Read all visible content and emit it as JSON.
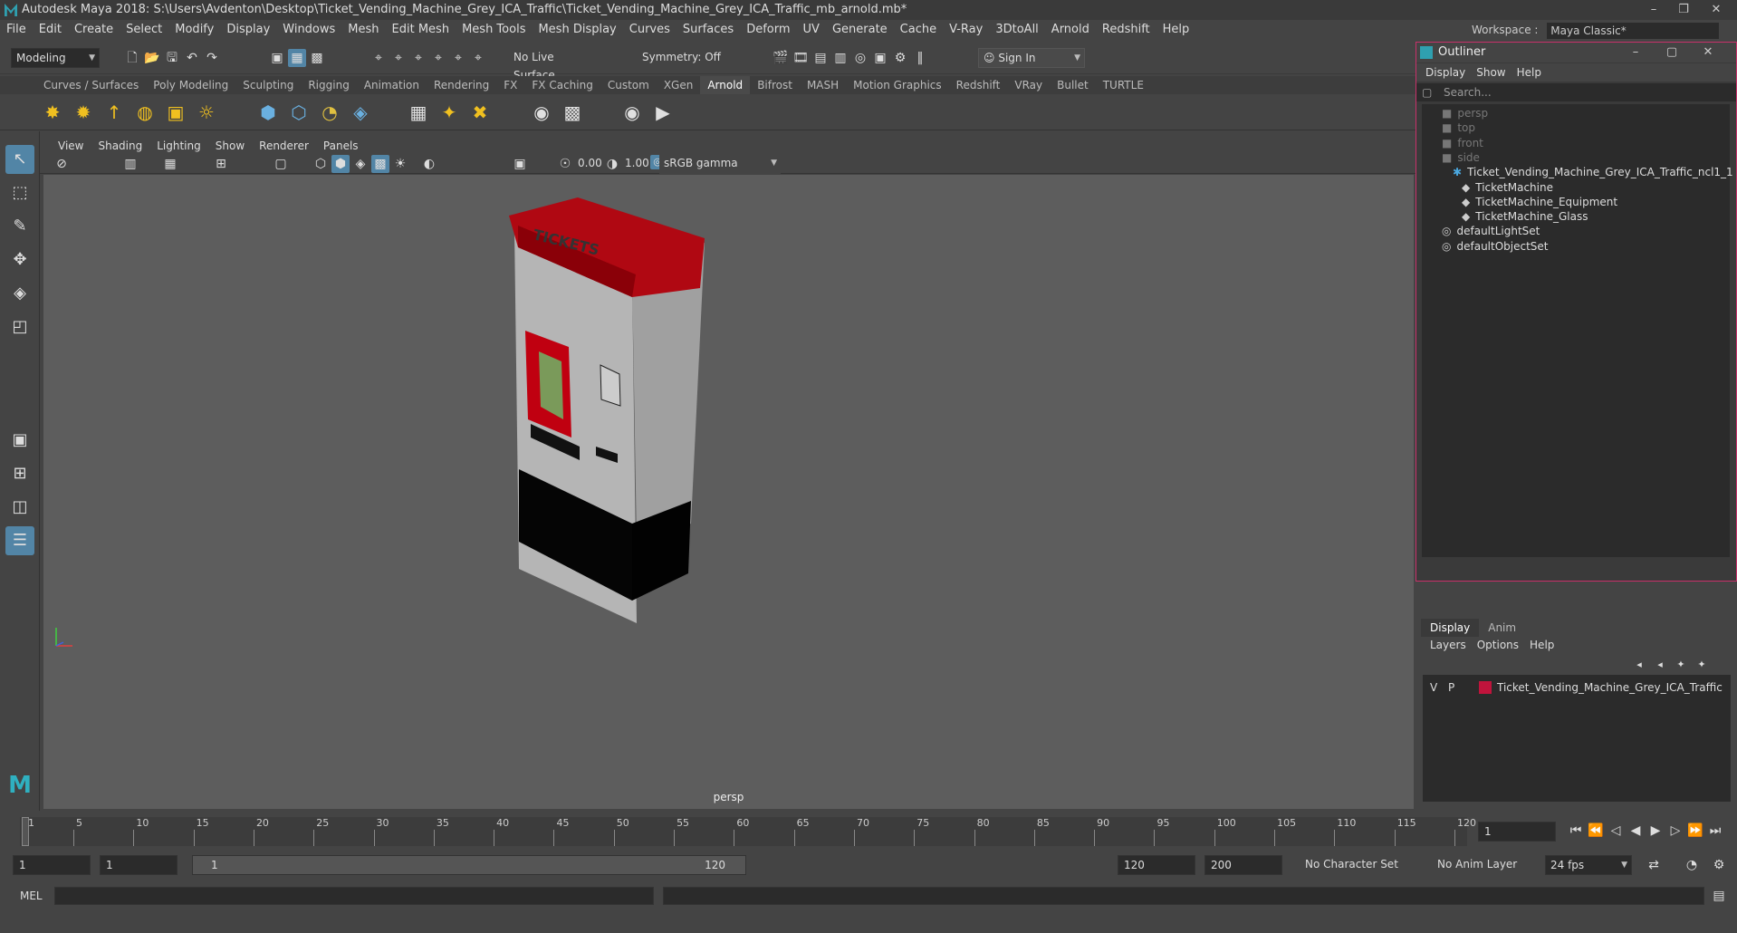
{
  "window": {
    "title": "Autodesk Maya 2018: S:\\Users\\Avdenton\\Desktop\\Ticket_Vending_Machine_Grey_ICA_Traffic\\Ticket_Vending_Machine_Grey_ICA_Traffic_mb_arnold.mb*",
    "workspace_label": "Workspace :",
    "workspace_value": "Maya Classic*"
  },
  "menubar": [
    "File",
    "Edit",
    "Create",
    "Select",
    "Modify",
    "Display",
    "Windows",
    "Mesh",
    "Edit Mesh",
    "Mesh Tools",
    "Mesh Display",
    "Curves",
    "Surfaces",
    "Deform",
    "UV",
    "Generate",
    "Cache",
    "V-Ray",
    "3DtoAll",
    "Arnold",
    "Redshift",
    "Help"
  ],
  "statusline": {
    "mode": "Modeling",
    "live_surface": "No Live Surface",
    "symmetry": "Symmetry: Off",
    "sign_in": "Sign In"
  },
  "shelf_tabs": [
    "Curves / Surfaces",
    "Poly Modeling",
    "Sculpting",
    "Rigging",
    "Animation",
    "Rendering",
    "FX",
    "FX Caching",
    "Custom",
    "XGen",
    "Arnold",
    "Bifrost",
    "MASH",
    "Motion Graphics",
    "Redshift",
    "VRay",
    "Bullet",
    "TURTLE"
  ],
  "active_shelf_tab": "Arnold",
  "panel_menu": [
    "View",
    "Shading",
    "Lighting",
    "Show",
    "Renderer",
    "Panels"
  ],
  "panel_toolbar": {
    "exposure": "0.00",
    "gamma": "1.00",
    "color_space": "sRGB gamma"
  },
  "viewport": {
    "camera_label": "persp",
    "model_label": "TICKETS",
    "colors": {
      "background": "#5d5d5d",
      "machine_red": "#b00812",
      "machine_grey": "#b8b8b8",
      "machine_black": "#050505"
    }
  },
  "outliner": {
    "title": "Outliner",
    "menu": [
      "Display",
      "Show",
      "Help"
    ],
    "search_placeholder": "Search...",
    "items": [
      {
        "label": "persp",
        "dim": true
      },
      {
        "label": "top",
        "dim": true
      },
      {
        "label": "front",
        "dim": true
      },
      {
        "label": "side",
        "dim": true
      },
      {
        "label": "Ticket_Vending_Machine_Grey_ICA_Traffic_ncl1_1",
        "dim": false
      },
      {
        "label": "TicketMachine",
        "dim": false
      },
      {
        "label": "TicketMachine_Equipment",
        "dim": false
      },
      {
        "label": "TicketMachine_Glass",
        "dim": false
      },
      {
        "label": "defaultLightSet",
        "dim": false
      },
      {
        "label": "defaultObjectSet",
        "dim": false
      }
    ]
  },
  "layer_editor": {
    "tabs": [
      "Display",
      "Anim"
    ],
    "menu": [
      "Layers",
      "Options",
      "Help"
    ],
    "layer": {
      "v": "V",
      "p": "P",
      "name": "Ticket_Vending_Machine_Grey_ICA_Traffic",
      "color": "#c0143c"
    }
  },
  "timeline": {
    "ticks": [
      "1",
      "5",
      "10",
      "15",
      "20",
      "25",
      "30",
      "35",
      "40",
      "45",
      "50",
      "55",
      "60",
      "65",
      "70",
      "75",
      "80",
      "85",
      "90",
      "95",
      "100",
      "105",
      "110",
      "115",
      "120"
    ],
    "current_frame": "1"
  },
  "range": {
    "start": "1",
    "playback_start": "1",
    "slider_start": "1",
    "slider_end": "120",
    "playback_end": "120",
    "end": "200",
    "character_set": "No Character Set",
    "anim_layer": "No Anim Layer",
    "fps": "24 fps"
  },
  "command_line": {
    "lang": "MEL"
  }
}
